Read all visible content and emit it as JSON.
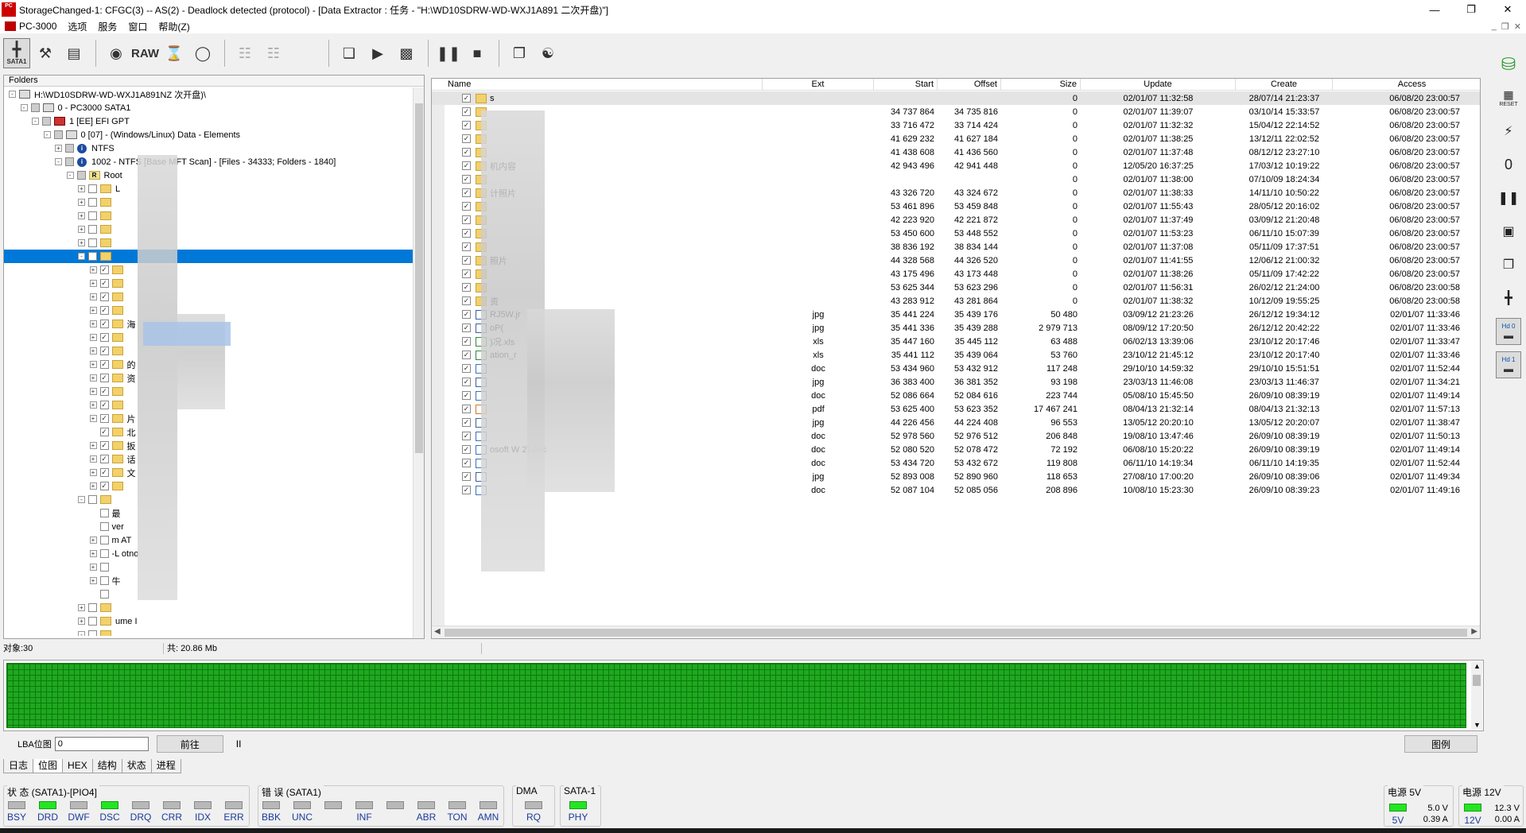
{
  "window": {
    "title": "StorageChanged-1: CFGC(3) -- AS(2) - Deadlock detected (protocol) - [Data Extractor : 任务 - \"H:\\WD10SDRW-WD-WXJ1A891           二次开盘)\"]",
    "app_icon_text": "PC"
  },
  "menu": {
    "items": [
      "PC-3000",
      "选项",
      "服务",
      "窗口",
      "帮助(Z)"
    ]
  },
  "toolbar": {
    "sata_label": "SATA1",
    "raw_label": "RAW"
  },
  "folders": {
    "header": "Folders",
    "nodes": [
      {
        "label": "H:\\WD10SDRW-WD-WXJ1A891NZ        次开盘)\\",
        "indent": 0,
        "icon": "drive",
        "exp": "-"
      },
      {
        "label": "0 - PC3000 SATA1",
        "indent": 1,
        "icon": "drive",
        "exp": "-"
      },
      {
        "label": "1 [EE] EFI GPT",
        "indent": 2,
        "icon": "red",
        "exp": "-"
      },
      {
        "label": "0 [07] - (Windows/Linux) Data - Elements",
        "indent": 3,
        "icon": "drive",
        "exp": "-"
      },
      {
        "label": "NTFS",
        "indent": 4,
        "icon": "info",
        "exp": "+"
      },
      {
        "label": "1002 - NTFS [Base MFT Scan] - [Files - 34333; Folders - 1840]",
        "indent": 4,
        "icon": "info",
        "exp": "-"
      },
      {
        "label": "Root",
        "indent": 5,
        "icon": "root",
        "exp": "-"
      },
      {
        "label": "L",
        "indent": 6,
        "icon": "folder",
        "exp": "+"
      },
      {
        "label": "",
        "indent": 6,
        "icon": "folder",
        "exp": "+"
      },
      {
        "label": "",
        "indent": 6,
        "icon": "folder",
        "exp": "+"
      },
      {
        "label": "",
        "indent": 6,
        "icon": "folder",
        "exp": "+"
      },
      {
        "label": "",
        "indent": 6,
        "icon": "folder",
        "exp": "+"
      },
      {
        "label": "",
        "indent": 6,
        "icon": "folder",
        "exp": "-",
        "sel": true
      },
      {
        "label": "",
        "indent": 7,
        "icon": "folder",
        "exp": "+"
      },
      {
        "label": "",
        "indent": 7,
        "icon": "folder",
        "exp": "+"
      },
      {
        "label": "",
        "indent": 7,
        "icon": "folder",
        "exp": "+"
      },
      {
        "label": "",
        "indent": 7,
        "icon": "folder",
        "exp": "+"
      },
      {
        "label": "海",
        "indent": 7,
        "icon": "folder",
        "exp": "+"
      },
      {
        "label": "",
        "indent": 7,
        "icon": "folder",
        "exp": "+"
      },
      {
        "label": "",
        "indent": 7,
        "icon": "folder",
        "exp": "+"
      },
      {
        "label": "的",
        "indent": 7,
        "icon": "folder",
        "exp": "+"
      },
      {
        "label": "资",
        "indent": 7,
        "icon": "folder",
        "exp": "+"
      },
      {
        "label": "",
        "indent": 7,
        "icon": "folder",
        "exp": "+"
      },
      {
        "label": "",
        "indent": 7,
        "icon": "folder",
        "exp": "+"
      },
      {
        "label": "片",
        "indent": 7,
        "icon": "folder",
        "exp": "+"
      },
      {
        "label": "北",
        "indent": 7,
        "icon": "folder",
        "exp": ""
      },
      {
        "label": "扳",
        "indent": 7,
        "icon": "folder",
        "exp": "+"
      },
      {
        "label": "话",
        "indent": 7,
        "icon": "folder",
        "exp": "+"
      },
      {
        "label": "文",
        "indent": 7,
        "icon": "folder",
        "exp": "+"
      },
      {
        "label": "",
        "indent": 7,
        "icon": "folder",
        "exp": "+"
      },
      {
        "label": "",
        "indent": 6,
        "icon": "folder",
        "exp": "-"
      },
      {
        "label": "最",
        "indent": 7,
        "icon": "blank",
        "exp": ""
      },
      {
        "label": "ver",
        "indent": 7,
        "icon": "blank",
        "exp": ""
      },
      {
        "label": "m        AT",
        "indent": 7,
        "icon": "blank",
        "exp": "+"
      },
      {
        "label": "-L      otno",
        "indent": 7,
        "icon": "blank",
        "exp": "+"
      },
      {
        "label": "",
        "indent": 7,
        "icon": "blank",
        "exp": "+"
      },
      {
        "label": "牛",
        "indent": 7,
        "icon": "blank",
        "exp": "+"
      },
      {
        "label": "",
        "indent": 7,
        "icon": "blank",
        "exp": ""
      },
      {
        "label": "",
        "indent": 6,
        "icon": "folder",
        "exp": "+"
      },
      {
        "label": "ume I",
        "indent": 6,
        "icon": "folder",
        "exp": "+"
      },
      {
        "label": "",
        "indent": 6,
        "icon": "folder",
        "exp": "-"
      }
    ]
  },
  "filelist": {
    "columns": {
      "name": "Name",
      "ext": "Ext",
      "start": "Start",
      "offset": "Offset",
      "size": "Size",
      "update": "Update",
      "create": "Create",
      "access": "Access"
    },
    "rows": [
      {
        "name": "s",
        "ext": "",
        "start": "",
        "offset": "",
        "size": "0",
        "update": "02/01/07 11:32:58",
        "create": "28/07/14 21:23:37",
        "access": "06/08/20 23:00:57",
        "icon": "fld"
      },
      {
        "name": "",
        "ext": "",
        "start": "34 737 864",
        "offset": "34 735 816",
        "size": "0",
        "update": "02/01/07 11:39:07",
        "create": "03/10/14 15:33:57",
        "access": "06/08/20 23:00:57",
        "icon": "fld"
      },
      {
        "name": "",
        "ext": "",
        "start": "33 716 472",
        "offset": "33 714 424",
        "size": "0",
        "update": "02/01/07 11:32:32",
        "create": "15/04/12 22:14:52",
        "access": "06/08/20 23:00:57",
        "icon": "fld"
      },
      {
        "name": "",
        "ext": "",
        "start": "41 629 232",
        "offset": "41 627 184",
        "size": "0",
        "update": "02/01/07 11:38:25",
        "create": "13/12/11 22:02:52",
        "access": "06/08/20 23:00:57",
        "icon": "fld"
      },
      {
        "name": "",
        "ext": "",
        "start": "41 438 608",
        "offset": "41 436 560",
        "size": "0",
        "update": "02/01/07 11:37:48",
        "create": "08/12/12 23:27:10",
        "access": "06/08/20 23:00:57",
        "icon": "fld"
      },
      {
        "name": "机内容",
        "ext": "",
        "start": "42 943 496",
        "offset": "42 941 448",
        "size": "0",
        "update": "12/05/20 16:37:25",
        "create": "17/03/12 10:19:22",
        "access": "06/08/20 23:00:57",
        "icon": "fld"
      },
      {
        "name": "",
        "ext": "",
        "start": "",
        "offset": "",
        "size": "0",
        "update": "02/01/07 11:38:00",
        "create": "07/10/09 18:24:34",
        "access": "06/08/20 23:00:57",
        "icon": "fld"
      },
      {
        "name": "计照片",
        "ext": "",
        "start": "43 326 720",
        "offset": "43 324 672",
        "size": "0",
        "update": "02/01/07 11:38:33",
        "create": "14/11/10 10:50:22",
        "access": "06/08/20 23:00:57",
        "icon": "fld"
      },
      {
        "name": "",
        "ext": "",
        "start": "53 461 896",
        "offset": "53 459 848",
        "size": "0",
        "update": "02/01/07 11:55:43",
        "create": "28/05/12 20:16:02",
        "access": "06/08/20 23:00:57",
        "icon": "fld"
      },
      {
        "name": "",
        "ext": "",
        "start": "42 223 920",
        "offset": "42 221 872",
        "size": "0",
        "update": "02/01/07 11:37:49",
        "create": "03/09/12 21:20:48",
        "access": "06/08/20 23:00:57",
        "icon": "fld"
      },
      {
        "name": "",
        "ext": "",
        "start": "53 450 600",
        "offset": "53 448 552",
        "size": "0",
        "update": "02/01/07 11:53:23",
        "create": "06/11/10 15:07:39",
        "access": "06/08/20 23:00:57",
        "icon": "fld"
      },
      {
        "name": "",
        "ext": "",
        "start": "38 836 192",
        "offset": "38 834 144",
        "size": "0",
        "update": "02/01/07 11:37:08",
        "create": "05/11/09 17:37:51",
        "access": "06/08/20 23:00:57",
        "icon": "fld"
      },
      {
        "name": "照片",
        "ext": "",
        "start": "44 328 568",
        "offset": "44 326 520",
        "size": "0",
        "update": "02/01/07 11:41:55",
        "create": "12/06/12 21:00:32",
        "access": "06/08/20 23:00:57",
        "icon": "fld"
      },
      {
        "name": "",
        "ext": "",
        "start": "43 175 496",
        "offset": "43 173 448",
        "size": "0",
        "update": "02/01/07 11:38:26",
        "create": "05/11/09 17:42:22",
        "access": "06/08/20 23:00:57",
        "icon": "fld"
      },
      {
        "name": "",
        "ext": "",
        "start": "53 625 344",
        "offset": "53 623 296",
        "size": "0",
        "update": "02/01/07 11:56:31",
        "create": "26/02/12 21:24:00",
        "access": "06/08/20 23:00:58",
        "icon": "fld"
      },
      {
        "name": "资",
        "ext": "",
        "start": "43 283 912",
        "offset": "43 281 864",
        "size": "0",
        "update": "02/01/07 11:38:32",
        "create": "10/12/09 19:55:25",
        "access": "06/08/20 23:00:58",
        "icon": "fld"
      },
      {
        "name": "                   RJ5W.jr",
        "ext": "jpg",
        "start": "35 441 224",
        "offset": "35 439 176",
        "size": "50 480",
        "update": "03/09/12 21:23:26",
        "create": "26/12/12 19:34:12",
        "access": "02/01/07 11:33:46",
        "icon": "jpg"
      },
      {
        "name": "  oP(",
        "ext": "jpg",
        "start": "35 441 336",
        "offset": "35 439 288",
        "size": "2 979 713",
        "update": "08/09/12 17:20:50",
        "create": "26/12/12 20:42:22",
        "access": "02/01/07 11:33:46",
        "icon": "jpg"
      },
      {
        "name": "                      )况.xls",
        "ext": "xls",
        "start": "35 447 160",
        "offset": "35 445 112",
        "size": "63 488",
        "update": "06/02/13 13:39:06",
        "create": "23/10/12 20:17:46",
        "access": "02/01/07 11:33:47",
        "icon": "xls"
      },
      {
        "name": "   ation_r",
        "ext": "xls",
        "start": "35 441 112",
        "offset": "35 439 064",
        "size": "53 760",
        "update": "23/10/12 21:45:12",
        "create": "23/10/12 20:17:40",
        "access": "02/01/07 11:33:46",
        "icon": "xls"
      },
      {
        "name": "",
        "ext": "doc",
        "start": "53 434 960",
        "offset": "53 432 912",
        "size": "117 248",
        "update": "29/10/10 14:59:32",
        "create": "29/10/10 15:51:51",
        "access": "02/01/07 11:52:44",
        "icon": "doc"
      },
      {
        "name": "",
        "ext": "jpg",
        "start": "36 383 400",
        "offset": "36 381 352",
        "size": "93 198",
        "update": "23/03/13 11:46:08",
        "create": "23/03/13 11:46:37",
        "access": "02/01/07 11:34:21",
        "icon": "jpg"
      },
      {
        "name": "",
        "ext": "doc",
        "start": "52 086 664",
        "offset": "52 084 616",
        "size": "223 744",
        "update": "05/08/10 15:45:50",
        "create": "26/09/10 08:39:19",
        "access": "02/01/07 11:49:14",
        "icon": "doc"
      },
      {
        "name": "",
        "ext": "pdf",
        "start": "53 625 400",
        "offset": "53 623 352",
        "size": "17 467 241",
        "update": "08/04/13 21:32:14",
        "create": "08/04/13 21:32:13",
        "access": "02/01/07 11:57:13",
        "icon": "pdf"
      },
      {
        "name": "",
        "ext": "jpg",
        "start": "44 226 456",
        "offset": "44 224 408",
        "size": "96 553",
        "update": "13/05/12 20:20:10",
        "create": "13/05/12 20:20:07",
        "access": "02/01/07 11:38:47",
        "icon": "jpg"
      },
      {
        "name": "",
        "ext": "doc",
        "start": "52 978 560",
        "offset": "52 976 512",
        "size": "206 848",
        "update": "19/08/10 13:47:46",
        "create": "26/09/10 08:39:19",
        "access": "02/01/07 11:50:13",
        "icon": "doc"
      },
      {
        "name": "osoft W         2).doc",
        "ext": "doc",
        "start": "52 080 520",
        "offset": "52 078 472",
        "size": "72 192",
        "update": "06/08/10 15:20:22",
        "create": "26/09/10 08:39:19",
        "access": "02/01/07 11:49:14",
        "icon": "doc"
      },
      {
        "name": "",
        "ext": "doc",
        "start": "53 434 720",
        "offset": "53 432 672",
        "size": "119 808",
        "update": "06/11/10 14:19:34",
        "create": "06/11/10 14:19:35",
        "access": "02/01/07 11:52:44",
        "icon": "doc"
      },
      {
        "name": "",
        "ext": "jpg",
        "start": "52 893 008",
        "offset": "52 890 960",
        "size": "118 653",
        "update": "27/08/10 17:00:20",
        "create": "26/09/10 08:39:06",
        "access": "02/01/07 11:49:34",
        "icon": "jpg"
      },
      {
        "name": "",
        "ext": "doc",
        "start": "52 087 104",
        "offset": "52 085 056",
        "size": "208 896",
        "update": "10/08/10 15:23:30",
        "create": "26/09/10 08:39:23",
        "access": "02/01/07 11:49:16",
        "icon": "doc"
      }
    ]
  },
  "status": {
    "objects": "对象:30",
    "total": "共: 20.86 Mb"
  },
  "lba": {
    "label": "LBA位图",
    "value": "0",
    "go_label": "前往",
    "pause": "II",
    "legend_label": "图例"
  },
  "tabs": [
    "日志",
    "位图",
    "HEX",
    "结构",
    "状态",
    "进程"
  ],
  "led_groups": {
    "status_title": "状 态 (SATA1)-[PIO4]",
    "error_title": "错 误 (SATA1)",
    "dma_title": "DMA",
    "sata_title": "SATA-1",
    "status_leds": [
      {
        "n": "BSY",
        "on": false
      },
      {
        "n": "DRD",
        "on": true
      },
      {
        "n": "DWF",
        "on": false
      },
      {
        "n": "DSC",
        "on": true
      },
      {
        "n": "DRQ",
        "on": false
      },
      {
        "n": "CRR",
        "on": false
      },
      {
        "n": "IDX",
        "on": false
      },
      {
        "n": "ERR",
        "on": false
      }
    ],
    "error_leds": [
      {
        "n": "BBK",
        "on": false
      },
      {
        "n": "UNC",
        "on": false
      },
      {
        "n": "",
        "on": false
      },
      {
        "n": "INF",
        "on": false
      },
      {
        "n": "",
        "on": false
      },
      {
        "n": "ABR",
        "on": false
      },
      {
        "n": "TON",
        "on": false
      },
      {
        "n": "AMN",
        "on": false
      }
    ],
    "dma_leds": [
      {
        "n": "RQ",
        "on": false
      }
    ],
    "sata_leds": [
      {
        "n": "PHY",
        "on": true
      }
    ]
  },
  "power": {
    "p5_title": "电源 5V",
    "p5_v": "5.0 V",
    "p5_a": "0.39 A",
    "p5_label": "5V",
    "p12_title": "电源 12V",
    "p12_v": "12.3 V",
    "p12_a": "0.00 A",
    "p12_label": "12V"
  },
  "sidebar": {
    "reset": "RESET",
    "hd0": "Hd 0",
    "hd1": "Hd 1"
  },
  "colors": {
    "selection": "#0078d7",
    "led_on": "#22e622",
    "led_off": "#b8b8b8",
    "map_green": "#1fa81f"
  }
}
